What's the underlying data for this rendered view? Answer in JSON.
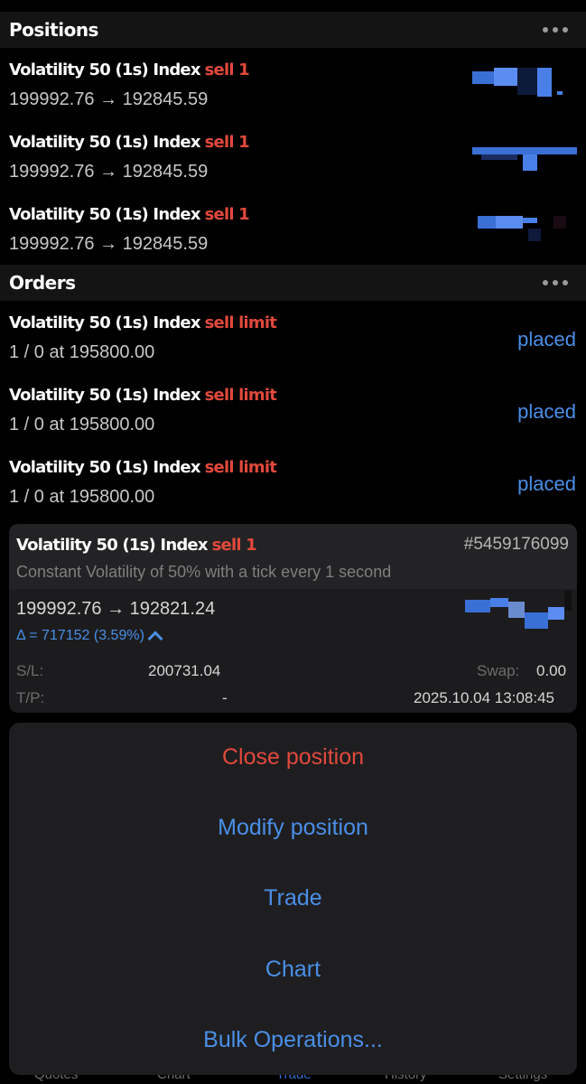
{
  "positions": {
    "title": "Positions",
    "items": [
      {
        "symbol": "Volatility 50 (1s) Index",
        "side": "sell 1",
        "prices": "199992.76 → 192845.59"
      },
      {
        "symbol": "Volatility 50 (1s) Index",
        "side": "sell 1",
        "prices": "199992.76 → 192845.59"
      },
      {
        "symbol": "Volatility 50 (1s) Index",
        "side": "sell 1",
        "prices": "199992.76 → 192845.59"
      }
    ]
  },
  "orders": {
    "title": "Orders",
    "items": [
      {
        "symbol": "Volatility 50 (1s) Index",
        "side": "sell limit",
        "detail": "1 / 0 at 195800.00",
        "status": "placed"
      },
      {
        "symbol": "Volatility 50 (1s) Index",
        "side": "sell limit",
        "detail": "1 / 0 at 195800.00",
        "status": "placed"
      },
      {
        "symbol": "Volatility 50 (1s) Index",
        "side": "sell limit",
        "detail": "1 / 0 at 195800.00",
        "status": "placed"
      }
    ]
  },
  "detail": {
    "symbol": "Volatility 50 (1s) Index",
    "side": "sell 1",
    "ticket": "#5459176099",
    "description": "Constant Volatility of 50% with a tick every 1 second",
    "prices": "199992.76 → 192821.24",
    "delta": "Δ = 717152 (3.59%)",
    "sl_label": "S/L:",
    "sl_value": "200731.04",
    "tp_label": "T/P:",
    "tp_value": "-",
    "swap_label": "Swap:",
    "swap_value": "0.00",
    "time": "2025.10.04 13:08:45"
  },
  "bottom_nav": {
    "items": [
      "Quotes",
      "Chart",
      "Trade",
      "History",
      "Settings"
    ],
    "active": "Trade"
  },
  "action_sheet": {
    "close": "Close position",
    "modify": "Modify position",
    "trade": "Trade",
    "chart": "Chart",
    "bulk": "Bulk Operations..."
  },
  "colors": {
    "sell": "#e2493c",
    "accent": "#4a8fe7",
    "background": "#000000"
  }
}
